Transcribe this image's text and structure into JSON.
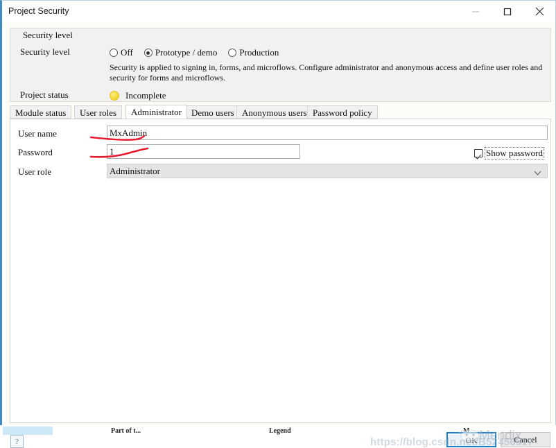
{
  "window": {
    "title": "Project Security",
    "buttons": {
      "minimize": "minimize",
      "maximize": "maximize",
      "close": "close"
    }
  },
  "security_group": {
    "legend": "Security level",
    "label": "Security level",
    "options": [
      {
        "label": "Off",
        "selected": false
      },
      {
        "label": "Prototype / demo",
        "selected": true
      },
      {
        "label": "Production",
        "selected": false
      }
    ],
    "description": "Security is applied to signing in, forms, and microflows. Configure administrator and anonymous access and define user roles and security for forms and microflows.",
    "status_label": "Project status",
    "status_value": "Incomplete",
    "status_color": "#f2d833"
  },
  "tabs": [
    {
      "label": "Module status",
      "active": false
    },
    {
      "label": "User roles",
      "active": false
    },
    {
      "label": "Administrator",
      "active": true
    },
    {
      "label": "Demo users",
      "active": false
    },
    {
      "label": "Anonymous users",
      "active": false
    },
    {
      "label": "Password policy",
      "active": false
    }
  ],
  "administrator_tab": {
    "user_name": {
      "label": "User name",
      "value": "MxAdmin"
    },
    "password": {
      "label": "Password",
      "value": "1"
    },
    "show_password": {
      "label": "Show password",
      "checked": true
    },
    "user_role": {
      "label": "User role",
      "value": "Administrator"
    }
  },
  "footer": {
    "help": "?",
    "ok": "OK",
    "cancel": "Cancel"
  },
  "watermarks": {
    "url": "https://blog.csdn.net/B52456517",
    "brand": "Mendix"
  },
  "background_window": {
    "columns": [
      "Part of t...",
      "Legend",
      "M"
    ]
  }
}
